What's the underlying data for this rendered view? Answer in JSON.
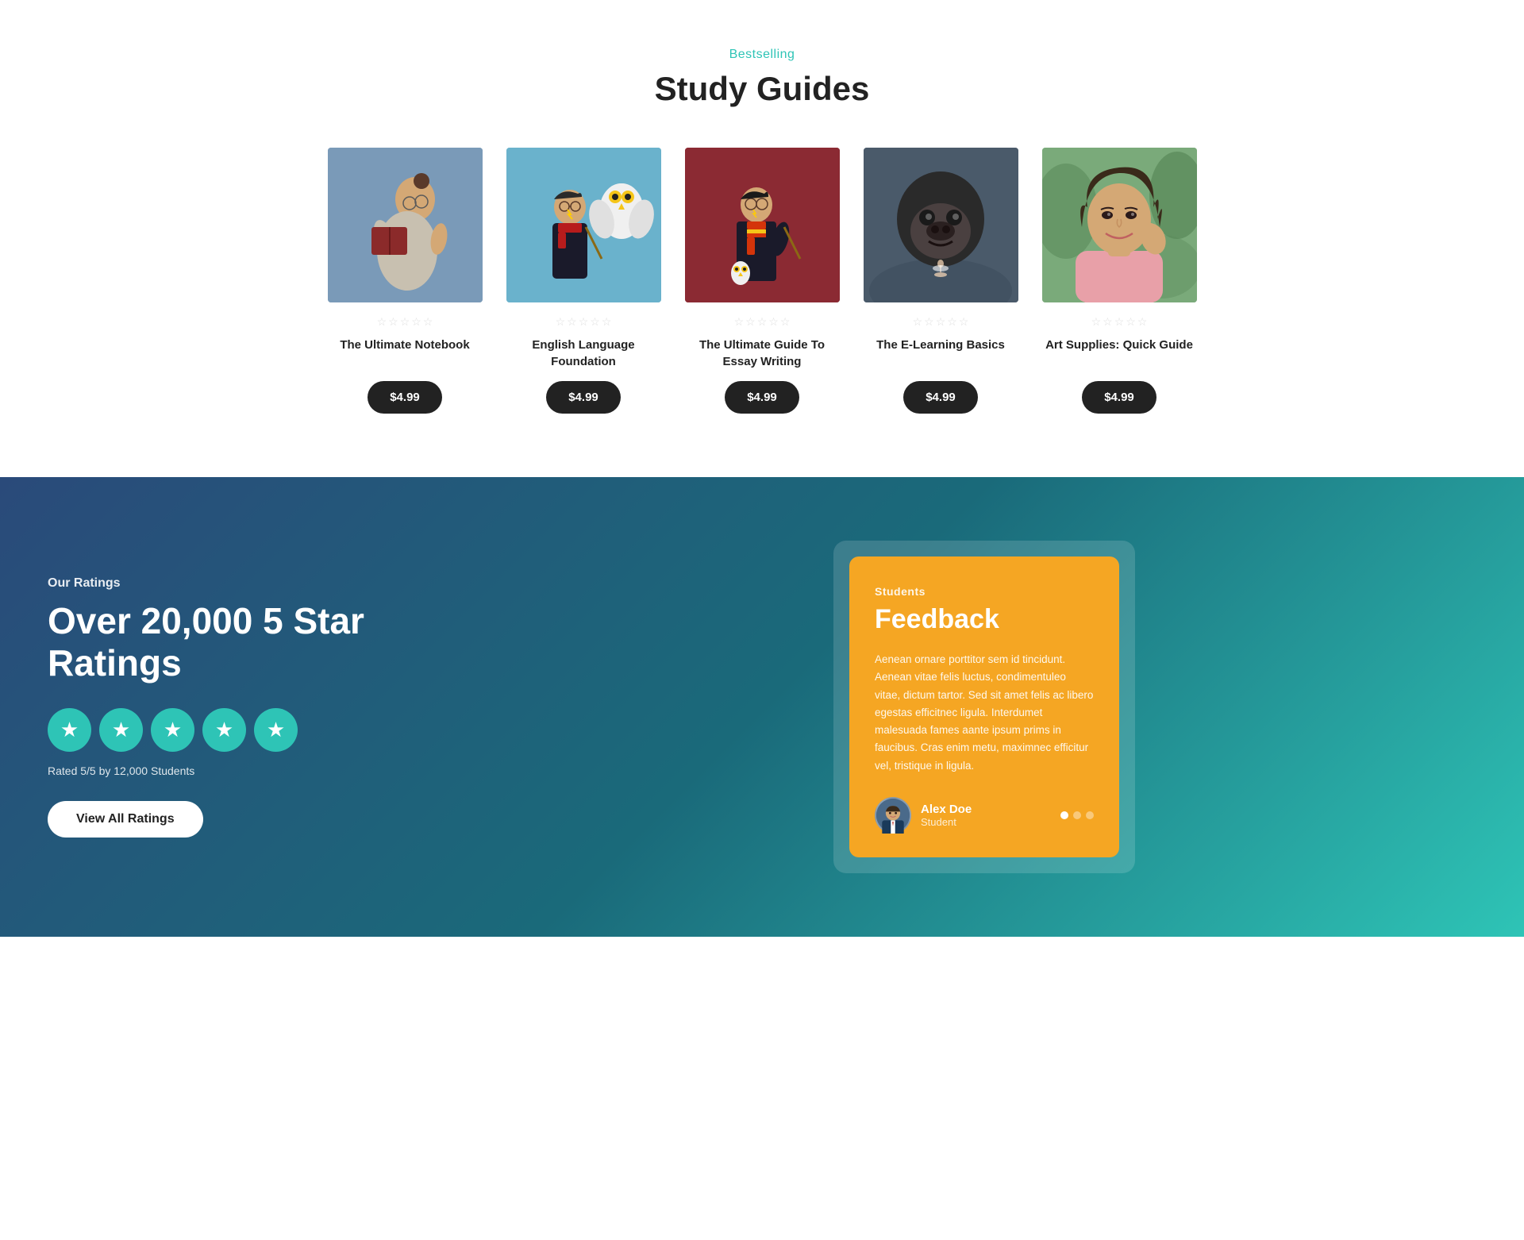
{
  "studyGuides": {
    "label": "Bestselling",
    "title": "Study Guides",
    "products": [
      {
        "id": 1,
        "name": "The Ultimate Notebook",
        "price": "$4.99",
        "imageClass": "figure-1",
        "stars": [
          false,
          false,
          false,
          false,
          false
        ]
      },
      {
        "id": 2,
        "name": "English Language Foundation",
        "price": "$4.99",
        "imageClass": "figure-2",
        "stars": [
          false,
          false,
          false,
          false,
          false
        ]
      },
      {
        "id": 3,
        "name": "The Ultimate Guide To Essay Writing",
        "price": "$4.99",
        "imageClass": "figure-3",
        "stars": [
          false,
          false,
          false,
          false,
          false
        ]
      },
      {
        "id": 4,
        "name": "The E-Learning Basics",
        "price": "$4.99",
        "imageClass": "figure-4",
        "stars": [
          false,
          false,
          false,
          false,
          false
        ]
      },
      {
        "id": 5,
        "name": "Art Supplies: Quick Guide",
        "price": "$4.99",
        "imageClass": "figure-5",
        "stars": [
          false,
          false,
          false,
          false,
          false
        ]
      }
    ]
  },
  "ratings": {
    "label": "Our Ratings",
    "headline": "Over 20,000 5 Star Ratings",
    "ratedText": "Rated 5/5 by 12,000 Students",
    "viewAllBtn": "View All Ratings",
    "feedback": {
      "category": "Students",
      "title": "Feedback",
      "text": "Aenean ornare porttitor sem id tincidunt. Aenean vitae felis luctus, condimentuleo vitae, dictum tartor. Sed sit amet felis ac libero egestas efficitnec ligula. Interdumet malesuada fames aante ipsum prims in faucibus. Cras enim metu, maximnec efficitur vel, tristique in ligula.",
      "reviewer": {
        "name": "Alex Doe",
        "role": "Student"
      },
      "dots": [
        true,
        false,
        false
      ]
    }
  }
}
